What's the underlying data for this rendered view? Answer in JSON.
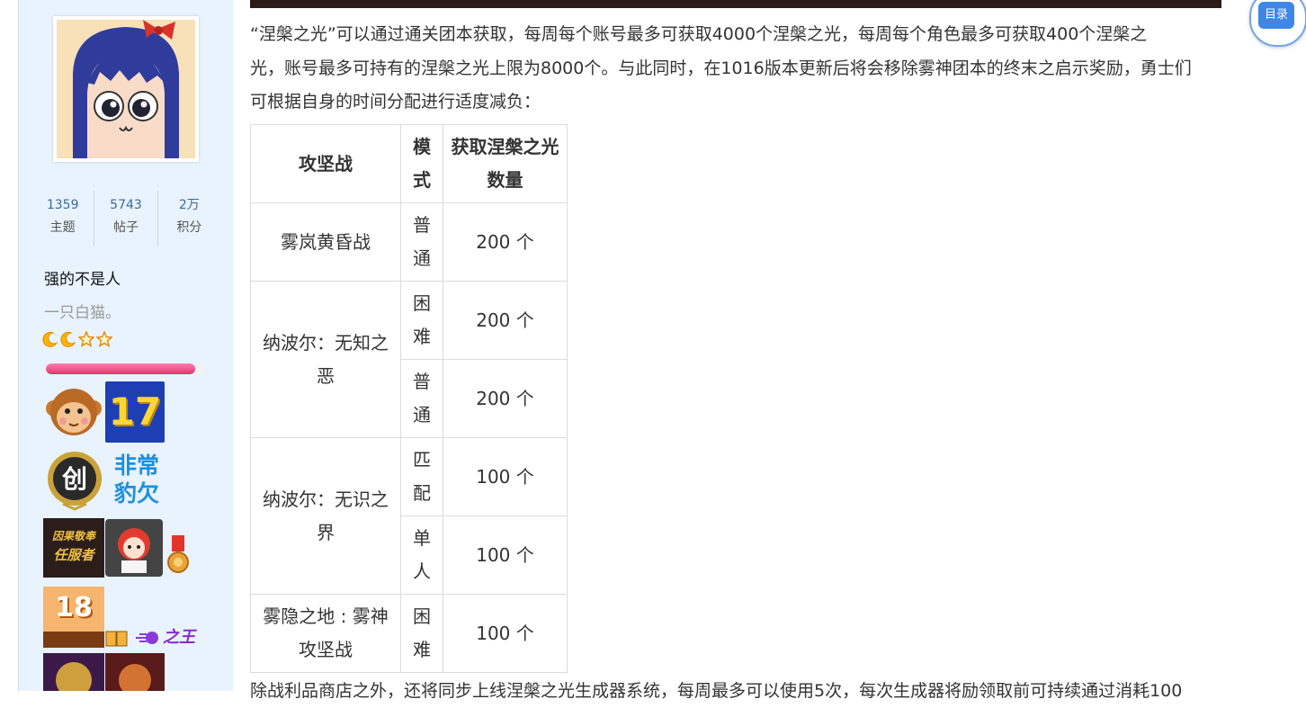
{
  "sidebar": {
    "stats": [
      {
        "value": "1359",
        "label": "主题"
      },
      {
        "value": "5743",
        "label": "帖子"
      },
      {
        "value": "2万",
        "label": "积分"
      }
    ],
    "username": "强的不是人",
    "custom_title": "一只白猫。",
    "progress": 0.93,
    "medals": {
      "badge_17": "17",
      "chuang": "创",
      "feichang_1": "非常",
      "feichang_2": "豹欠",
      "naixin_1": "因果敬奉",
      "naixin_2": "任服者",
      "cake": "18",
      "zhi_wang": "之王"
    }
  },
  "toc": {
    "label": "目录"
  },
  "article": {
    "para_lines": [
      "“涅槃之光”可以通过通关团本获取，每周每个账号最多可获取4000个涅槃之光，每周每个角色最多可获取400个涅槃之",
      "光，账号最多可持有的涅槃之光上限为8000个。与此同时，在1016版本更新后将会移除雾神团本的终末之启示奖励，勇士们",
      "可根据自身的时间分配进行适度减负："
    ],
    "table": {
      "headers": [
        "攻坚战",
        "模式",
        "获取涅槃之光数量"
      ],
      "rows": [
        {
          "raid": "雾岚黄昏战",
          "mode": "普通",
          "count": "200 个"
        },
        {
          "raid": "纳波尔：无知之恶",
          "mode": "困难",
          "count": "200 个"
        },
        {
          "raid": "",
          "mode": "普通",
          "count": "200 个"
        },
        {
          "raid": "纳波尔：无识之界",
          "mode": "匹配",
          "count": "100 个"
        },
        {
          "raid": "",
          "mode": "单人",
          "count": "100 个"
        },
        {
          "raid": "雾隐之地 : 雾神攻坚战",
          "mode": "困难",
          "count": "100 个"
        }
      ]
    },
    "bottom_line": "除战利品商店之外，还将同步上线涅槃之光生成器系统，每周最多可以使用5次，每次生成器将励领取前可持续通过消耗100"
  },
  "colors": {
    "sidebar_bg": "#e8f3fd",
    "stat_number": "#3a6a9a",
    "progress": "#e6336f",
    "toc_accent": "#3e87e6"
  }
}
